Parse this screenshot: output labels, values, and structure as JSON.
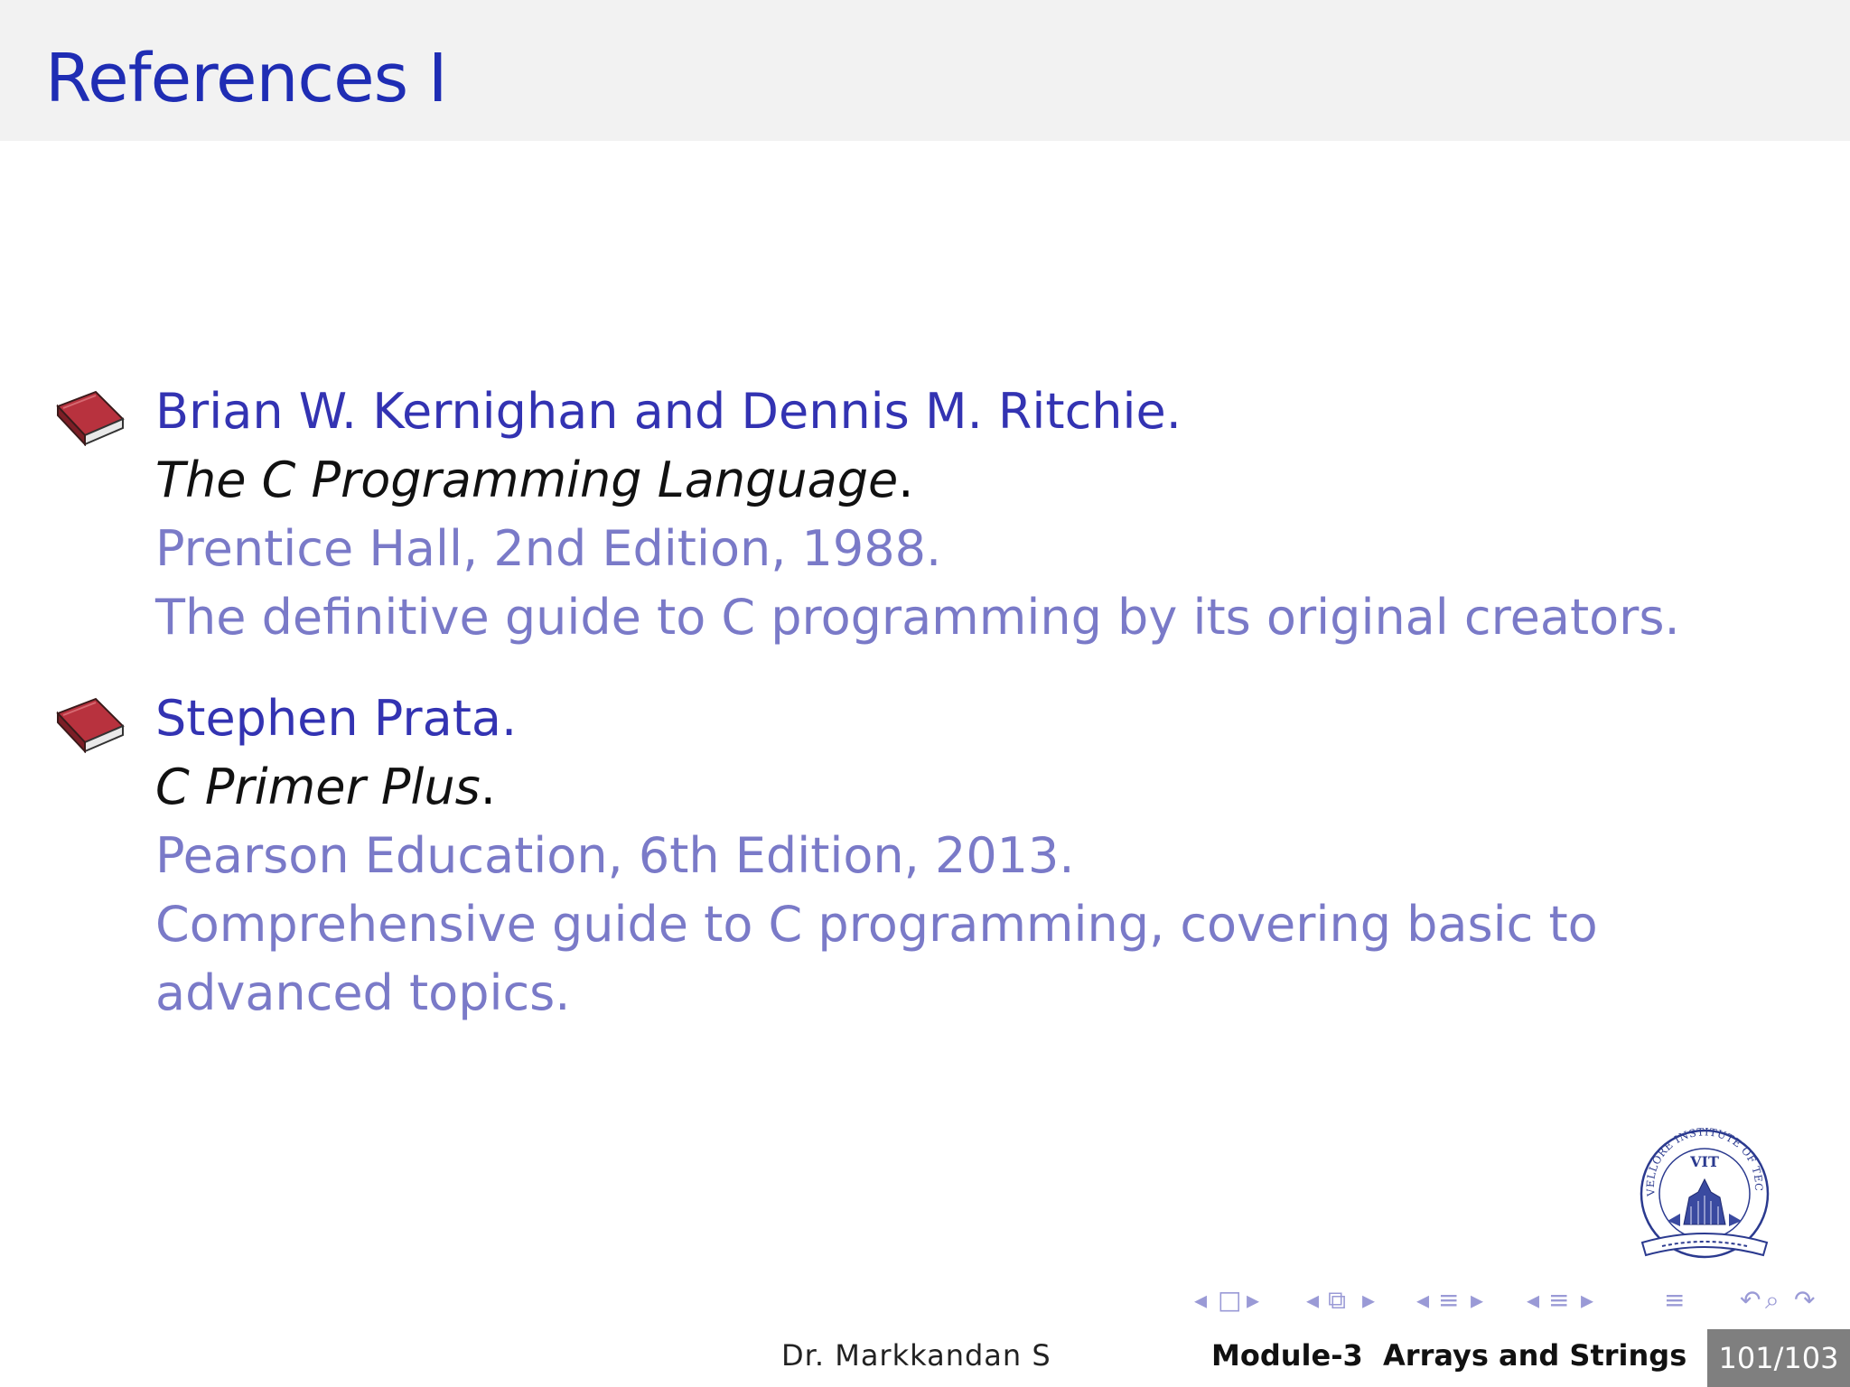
{
  "slide": {
    "title": "References I"
  },
  "references": [
    {
      "author": "Brian W. Kernighan and Dennis M. Ritchie.",
      "work": "The C Programming Language",
      "work_suffix": ".",
      "publisher": "Prentice Hall, 2nd Edition, 1988.",
      "note": "The definitive guide to C programming by its original creators.",
      "icon": "book-icon"
    },
    {
      "author": "Stephen Prata.",
      "work": "C Primer Plus",
      "work_suffix": ".",
      "publisher": "Pearson Education, 6th Edition, 2013.",
      "note": "Comprehensive guide to C programming, covering basic to advanced topics.",
      "icon": "book-icon"
    }
  ],
  "logo": {
    "text_top": "VELLORE INSTITUTE OF TECHNOLOGY",
    "text_center": "VIT",
    "icon": "vit-seal-logo"
  },
  "footer": {
    "author": "Dr. Markkandan S",
    "module": "Module-3",
    "topic": "Arrays and Strings",
    "page": "101/103"
  },
  "colors": {
    "title": "#1f2db4",
    "author": "#3333b2",
    "publisher": "#7a7ac8",
    "title_bar": "#f2f2f2",
    "page_badge": "#7f7f7f"
  }
}
